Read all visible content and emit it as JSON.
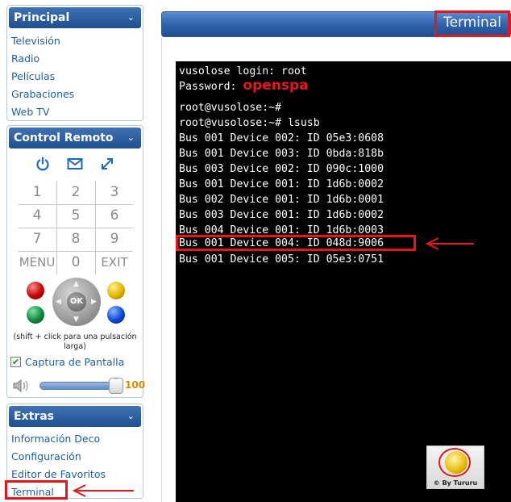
{
  "sidebar": {
    "principal": {
      "title": "Principal",
      "items": [
        {
          "label": "Televisión"
        },
        {
          "label": "Radio"
        },
        {
          "label": "Películas"
        },
        {
          "label": "Grabaciones"
        },
        {
          "label": "Web TV"
        }
      ]
    },
    "remote": {
      "title": "Control Remoto",
      "icons": [
        "power-icon",
        "mail-icon",
        "fullscreen-icon"
      ],
      "keys": [
        "1",
        "2",
        "3",
        "4",
        "5",
        "6",
        "7",
        "8",
        "9",
        "MENU",
        "0",
        "EXIT"
      ],
      "color_buttons": {
        "red": "#c40000",
        "green": "#0b8a3c",
        "yellow": "#e2b400",
        "blue": "#0b46d6"
      },
      "ok_label": "OK",
      "hint": "(shift + click para una pulsación larga)",
      "capture_label": "Captura de Pantalla",
      "capture_checked": true,
      "volume_value": "100"
    },
    "extras": {
      "title": "Extras",
      "items": [
        {
          "label": "Información Deco"
        },
        {
          "label": "Configuración"
        },
        {
          "label": "Editor de Favoritos"
        },
        {
          "label": "Terminal"
        }
      ]
    }
  },
  "main": {
    "title": "Terminal",
    "terminal": {
      "login_line": "vusolose login: root",
      "password_prefix": "Password: ",
      "password_value": "openspa",
      "prompt1": "root@vusolose:~#",
      "prompt2": "root@vusolose:~# lsusb",
      "lines": [
        "Bus 001 Device 002: ID 05e3:0608",
        "Bus 001 Device 003: ID 0bda:818b",
        "Bus 003 Device 002: ID 090c:1000",
        "Bus 001 Device 001: ID 1d6b:0002",
        "Bus 002 Device 001: ID 1d6b:0001",
        "Bus 003 Device 001: ID 1d6b:0002",
        "Bus 004 Device 001: ID 1d6b:0003",
        "Bus 001 Device 004: ID 048d:9006",
        "Bus 001 Device 005: ID 05e3:0751"
      ]
    },
    "watermark": "© By Tururu"
  },
  "colors": {
    "accent_blue": "#2e63ad",
    "highlight_red": "#e8161b",
    "link_blue": "#1e5f9e",
    "terminal_bg": "#000000"
  }
}
